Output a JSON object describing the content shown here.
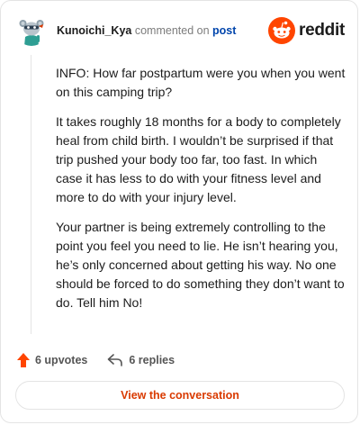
{
  "header": {
    "username": "Kunoichi_Kya",
    "action_text": "commented on",
    "target_text": "post",
    "brand": "reddit"
  },
  "comment": {
    "paragraphs": [
      "INFO: How far postpartum were you when you went on this camping trip?",
      "It takes roughly 18 months for a body to completely heal from child birth. I wouldn’t be surprised if that trip pushed your body too far, too fast. In which case it has less to do with your fitness level and more to do with your injury level.",
      "Your partner is being extremely controlling to the point you feel you need to lie. He isn’t hearing you, he’s only concerned about getting his way. No one should be forced to do something they don’t want to do. Tell him No!"
    ]
  },
  "actions": {
    "upvotes": "6 upvotes",
    "replies": "6 replies"
  },
  "footer": {
    "button_label": "View the conversation"
  },
  "colors": {
    "accent": "#d93a00",
    "link": "#0045ac",
    "upvote": "#ff4500"
  }
}
